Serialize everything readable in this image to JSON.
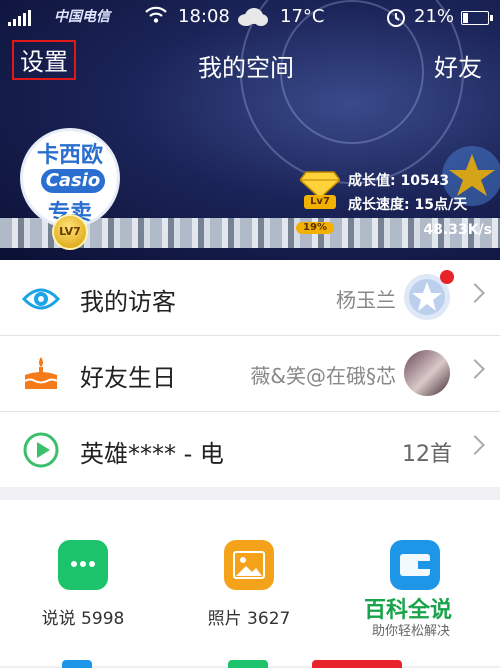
{
  "status": {
    "carrier": "中国电信",
    "time": "18:08",
    "temperature": "17°C",
    "battery": "21%",
    "battery_level": 0.21
  },
  "nav": {
    "left": "设置",
    "title": "我的空间",
    "right": "好友"
  },
  "profile": {
    "avatar_line1": "卡西欧",
    "avatar_line2": "Casio",
    "avatar_line3": "专卖",
    "level": "LV7",
    "gem_level": "Lv7",
    "growth_value": "成长值: 10543",
    "growth_speed": "成长速度: 15点/天",
    "progress": "19%",
    "net_speed": "48.33K/s"
  },
  "list": [
    {
      "label": "我的访客",
      "value": "杨玉兰",
      "icon": "eye-icon",
      "thumb": "qzone-avatar",
      "has_dot": true
    },
    {
      "label": "好友生日",
      "value": "薇&笑@在硪§芯",
      "icon": "cake-icon",
      "thumb": "friend-photo",
      "has_dot": false
    },
    {
      "label": "英雄**** - 电",
      "value": "12首",
      "icon": "play-icon",
      "thumb": "",
      "has_dot": false
    }
  ],
  "grid": [
    {
      "label": "说说 5998",
      "icon": "chat-bubble-icon",
      "color": "#1cc36a"
    },
    {
      "label": "照片 3627",
      "icon": "photo-icon",
      "color": "#f5a21b"
    },
    {
      "label": "",
      "icon": "wallet-icon",
      "color": "#1e96e8"
    }
  ],
  "watermark": {
    "title": "百科全说",
    "subtitle": "助你轻松解决"
  }
}
